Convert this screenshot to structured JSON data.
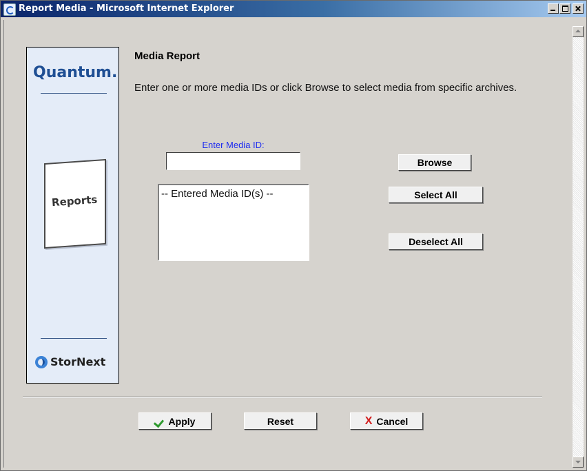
{
  "window": {
    "title": "Report Media - Microsoft Internet Explorer"
  },
  "sidebar": {
    "brand": "Quantum.",
    "section": "Reports",
    "product": "StorNext"
  },
  "main": {
    "title": "Media Report",
    "instructions": "Enter one or more media IDs or click Browse to select media from specific archives.",
    "media_id_label": "Enter Media ID:",
    "media_id_value": "",
    "media_list": [
      "-- Entered Media ID(s) --"
    ]
  },
  "buttons": {
    "browse": "Browse",
    "select_all": "Select All",
    "deselect_all": "Deselect All",
    "apply": "Apply",
    "reset": "Reset",
    "cancel": "Cancel"
  },
  "icons": {
    "apply": "check-icon",
    "cancel": "x-icon",
    "cancel_glyph": "X"
  },
  "colors": {
    "label_blue": "#1e2cf0",
    "brand_blue": "#1f4f94",
    "sidebar_bg": "#e4ecf8"
  }
}
